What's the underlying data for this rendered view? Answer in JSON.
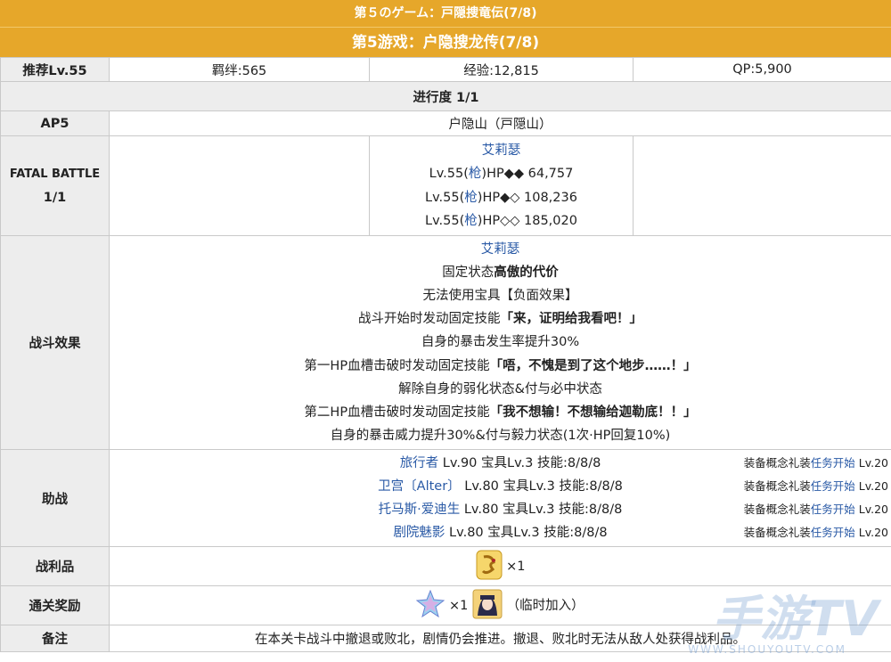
{
  "header": {
    "jp_title": "第５のゲーム：戸隠捜竜伝(7/8)",
    "cn_title": "第5游戏：户隐搜龙传(7/8)"
  },
  "stats": {
    "recommend": "推荐Lv.55",
    "bond": "羁绊:565",
    "exp": "经验:12,815",
    "qp": "QP:5,900"
  },
  "progress": "进行度 1/1",
  "ap": {
    "label": "AP5",
    "location": "户隐山（戸隠山）"
  },
  "fatal": {
    "label_line1": "FATAL BATTLE",
    "label_line2": "1/1",
    "enemy_name": "艾莉瑟",
    "rows": [
      {
        "lv": "Lv.55(",
        "cls": "枪",
        "hp": ")HP◆◆ 64,757"
      },
      {
        "lv": "Lv.55(",
        "cls": "枪",
        "hp": ")HP◆◇ 108,236"
      },
      {
        "lv": "Lv.55(",
        "cls": "枪",
        "hp": ")HP◇◇ 185,020"
      }
    ]
  },
  "effects": {
    "label": "战斗效果",
    "name": "艾莉瑟",
    "lines": [
      {
        "pre": "固定状态",
        "bold": "高傲的代价",
        "post": ""
      },
      {
        "pre": "无法使用宝具【负面效果】",
        "bold": "",
        "post": ""
      },
      {
        "pre": "战斗开始时发动固定技能",
        "bold": "「来，证明给我看吧！」",
        "post": ""
      },
      {
        "pre": "自身的暴击发生率提升30%",
        "bold": "",
        "post": ""
      },
      {
        "pre": "第一HP血槽击破时发动固定技能",
        "bold": "「唔，不愧是到了这个地步……！」",
        "post": ""
      },
      {
        "pre": "解除自身的弱化状态&付与必中状态",
        "bold": "",
        "post": ""
      },
      {
        "pre": "第二HP血槽击破时发动固定技能",
        "bold": "「我不想输！不想输给迦勒底！！」",
        "post": ""
      },
      {
        "pre": "自身的暴击威力提升30%&付与毅力状态(1次·HP回复10%)",
        "bold": "",
        "post": ""
      }
    ]
  },
  "support": {
    "label": "助战",
    "rows": [
      {
        "name": "旅行者",
        "info": " Lv.90 宝具Lv.3 技能:8/8/8",
        "ce_pre": "装备概念礼装",
        "ce_link": "任务开始",
        "ce_lv": " Lv.20"
      },
      {
        "name": "卫宫〔Alter〕",
        "info": " Lv.80 宝具Lv.3 技能:8/8/8",
        "ce_pre": "装备概念礼装",
        "ce_link": "任务开始",
        "ce_lv": " Lv.20"
      },
      {
        "name": "托马斯·爱迪生",
        "info": " Lv.80 宝具Lv.3 技能:8/8/8",
        "ce_pre": "装备概念礼装",
        "ce_link": "任务开始",
        "ce_lv": " Lv.20"
      },
      {
        "name": "剧院魅影",
        "info": " Lv.80 宝具Lv.3 技能:8/8/8",
        "ce_pre": "装备概念礼装",
        "ce_link": "任务开始",
        "ce_lv": " Lv.20"
      }
    ]
  },
  "drops": {
    "label": "战利品",
    "qty": "×1"
  },
  "clear_reward": {
    "label": "通关奖励",
    "qty": "×1",
    "note": "（临时加入）"
  },
  "notes": {
    "label": "备注",
    "text": "在本关卡战斗中撤退或败北，剧情仍会推进。撤退、败北时无法从敌人处获得战利品。"
  },
  "watermark": {
    "text": "手游TV",
    "url": "WWW.SHOUYOUTV.COM"
  },
  "colors": {
    "header": "#e6a72a",
    "label_bg": "#ededed",
    "link": "#2a5aa6"
  }
}
